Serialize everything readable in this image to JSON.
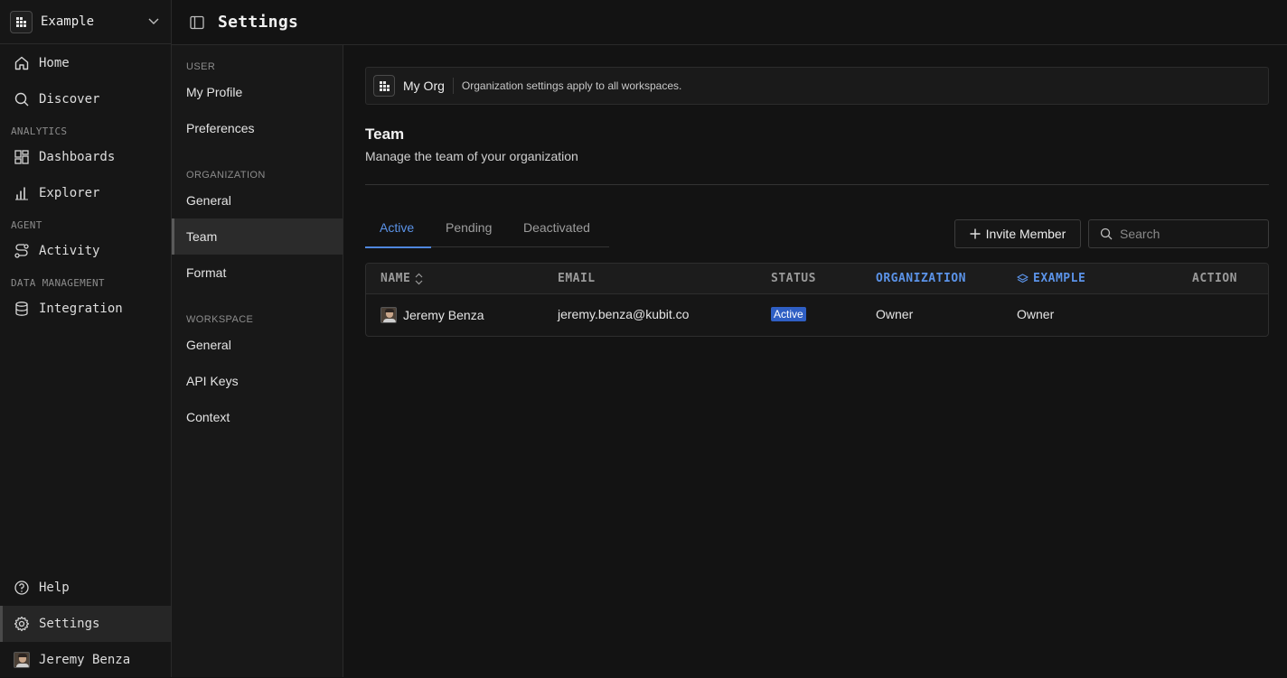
{
  "workspace": {
    "name": "Example"
  },
  "sidebar": {
    "items": [
      {
        "label": "Home",
        "icon": "home-icon"
      },
      {
        "label": "Discover",
        "icon": "search-icon"
      },
      {
        "label": "Dashboards",
        "icon": "dashboard-icon"
      },
      {
        "label": "Explorer",
        "icon": "bar-chart-icon"
      },
      {
        "label": "Activity",
        "icon": "route-icon"
      },
      {
        "label": "Integration",
        "icon": "database-icon"
      }
    ],
    "sections": [
      "ANALYTICS",
      "AGENT",
      "DATA MANAGEMENT"
    ],
    "help": "Help",
    "settings": "Settings",
    "user": "Jeremy Benza"
  },
  "header": {
    "title": "Settings"
  },
  "settings_nav": {
    "user_section": "USER",
    "user_items": [
      "My Profile",
      "Preferences"
    ],
    "org_section": "ORGANIZATION",
    "org_items": [
      "General",
      "Team",
      "Format"
    ],
    "workspace_section": "WORKSPACE",
    "workspace_items": [
      "General",
      "API Keys",
      "Context"
    ]
  },
  "org_banner": {
    "name": "My Org",
    "note": "Organization settings apply to all workspaces."
  },
  "team": {
    "title": "Team",
    "subtitle": "Manage the team of your organization"
  },
  "tabs": [
    "Active",
    "Pending",
    "Deactivated"
  ],
  "actions": {
    "invite": "Invite Member",
    "search_placeholder": "Search"
  },
  "table": {
    "headers": {
      "name": "NAME",
      "email": "EMAIL",
      "status": "STATUS",
      "organization": "ORGANIZATION",
      "workspace": "EXAMPLE",
      "action": "ACTION"
    },
    "rows": [
      {
        "name": "Jeremy Benza",
        "email": "jeremy.benza@kubit.co",
        "status": "Active",
        "organization": "Owner",
        "workspace": "Owner"
      }
    ]
  },
  "colors": {
    "accent": "#5b93e8",
    "badge": "#2f5fc4",
    "background": "#131313"
  }
}
